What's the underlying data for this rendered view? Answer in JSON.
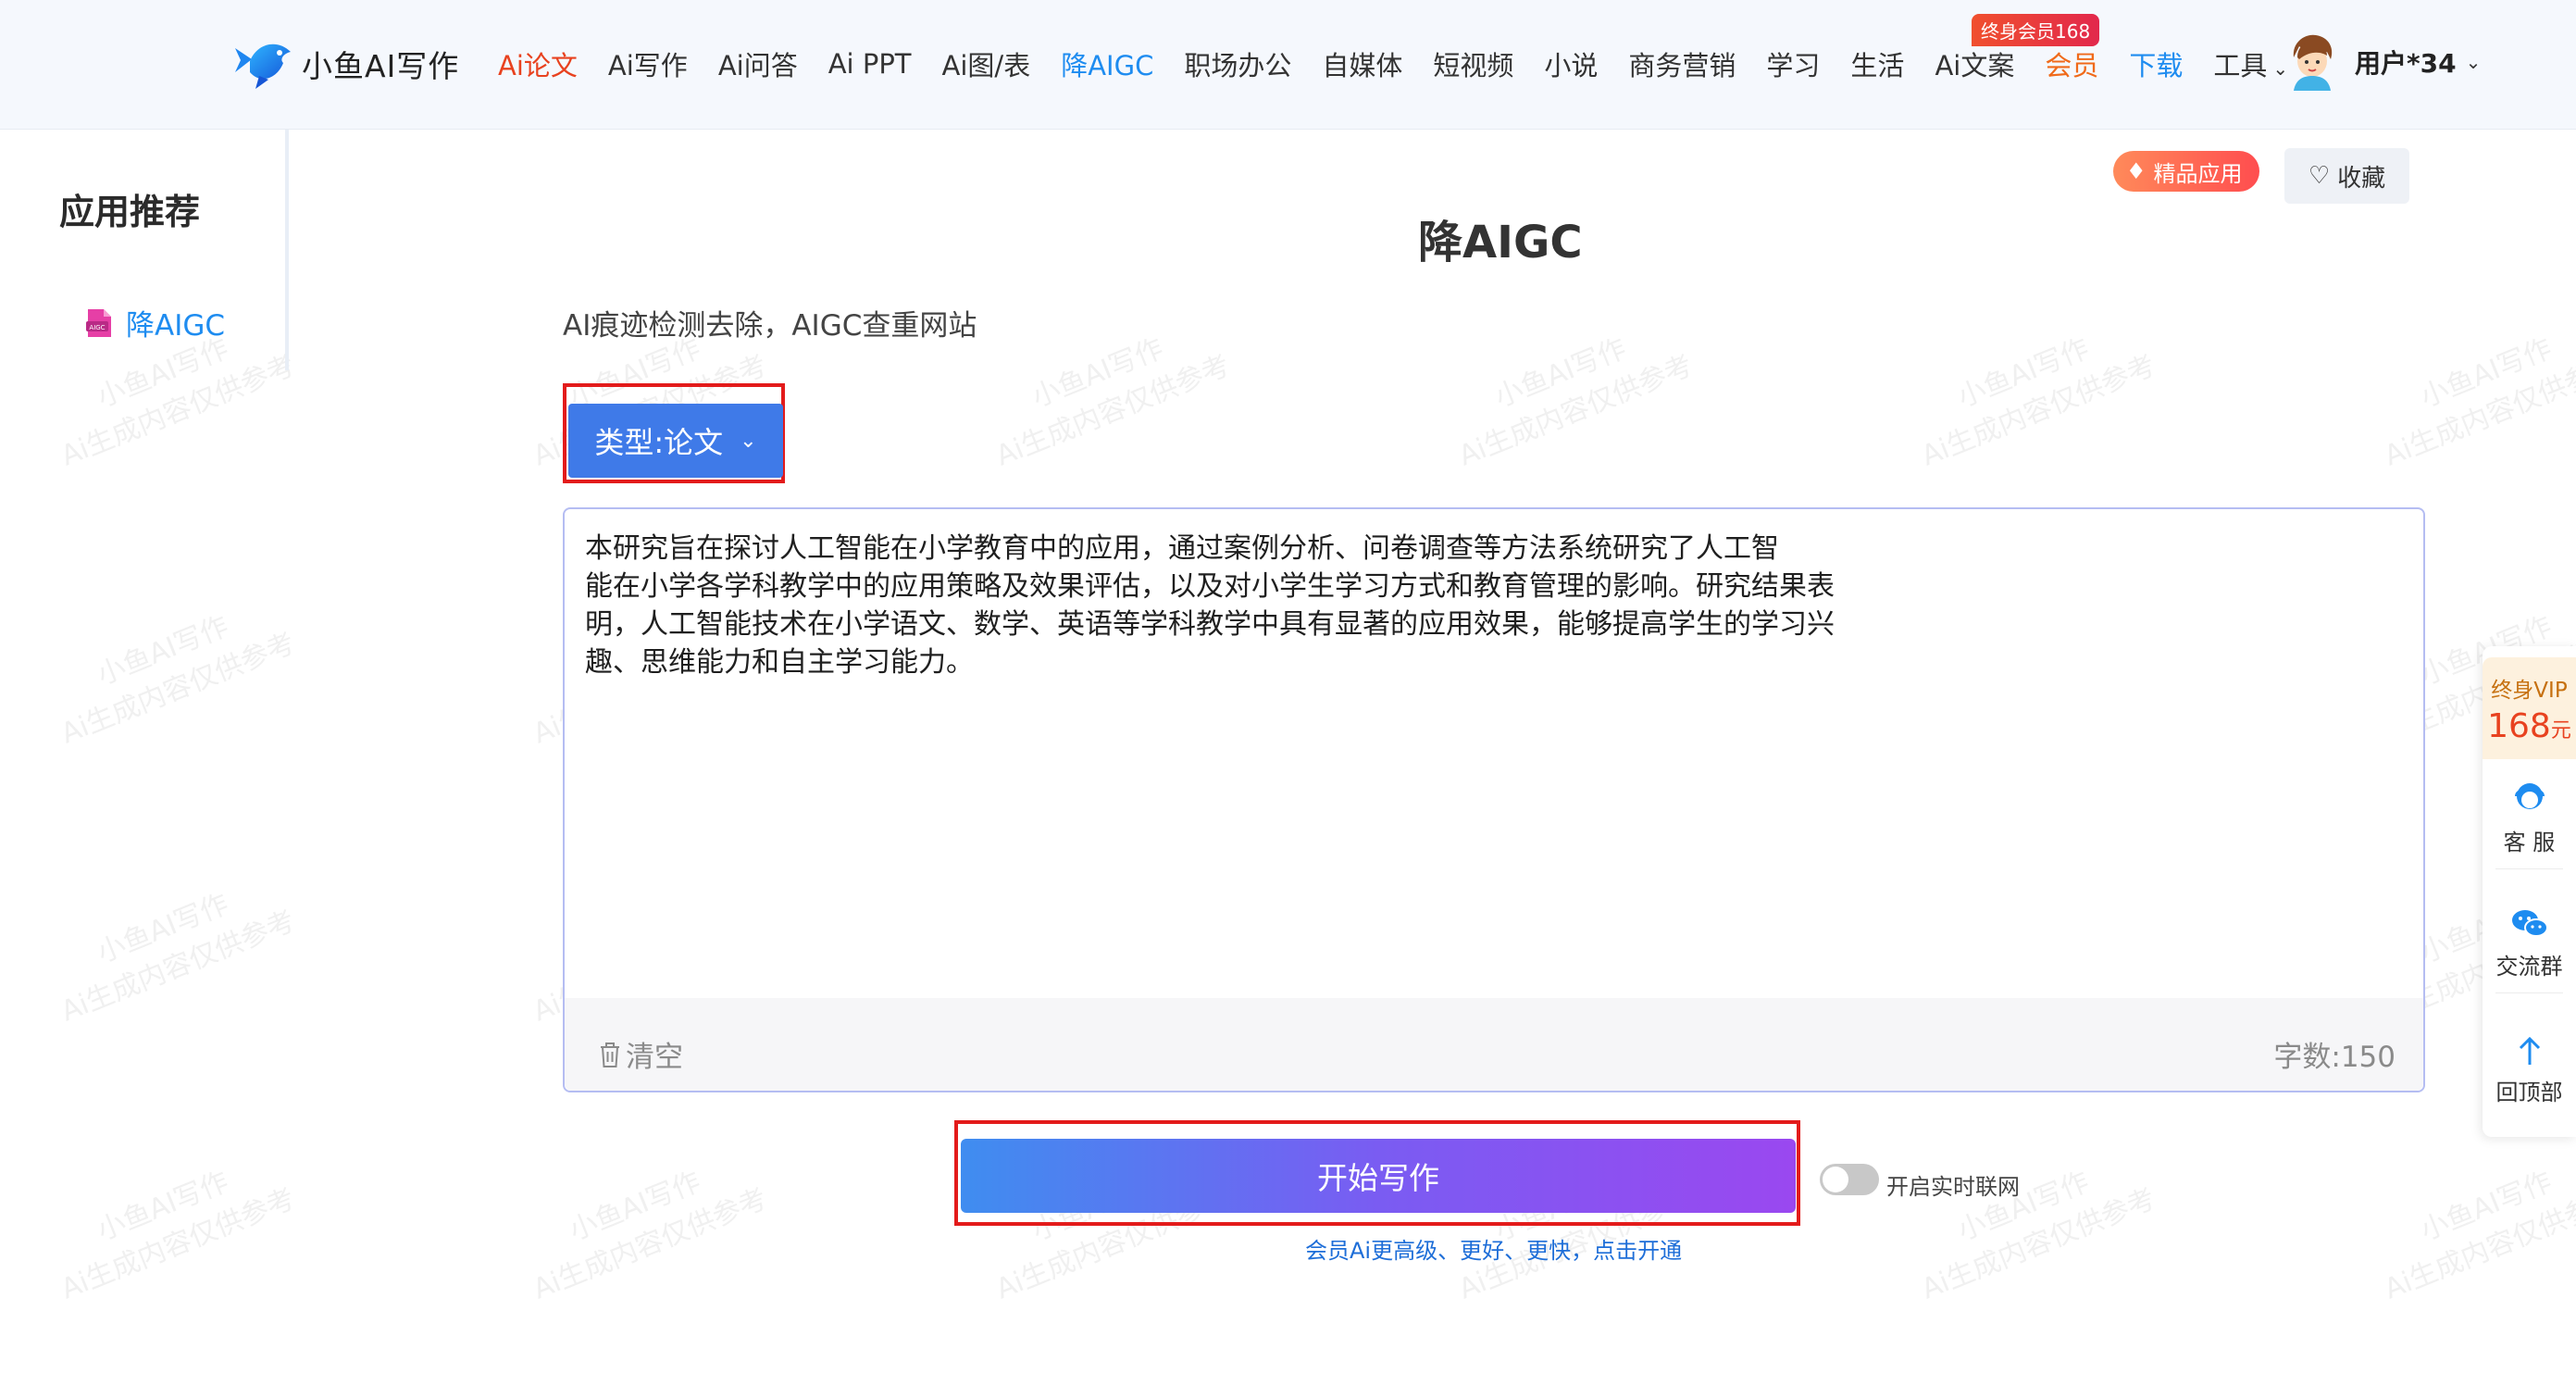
{
  "header": {
    "logo_text": "小鱼AI写作",
    "nav": [
      {
        "label": "Ai论文",
        "style": "red"
      },
      {
        "label": "Ai写作",
        "style": ""
      },
      {
        "label": "Ai问答",
        "style": ""
      },
      {
        "label": "Ai PPT",
        "style": ""
      },
      {
        "label": "Ai图/表",
        "style": ""
      },
      {
        "label": "降AIGC",
        "style": "blue"
      },
      {
        "label": "职场办公",
        "style": ""
      },
      {
        "label": "自媒体",
        "style": ""
      },
      {
        "label": "短视频",
        "style": ""
      },
      {
        "label": "小说",
        "style": ""
      },
      {
        "label": "商务营销",
        "style": ""
      },
      {
        "label": "学习",
        "style": ""
      },
      {
        "label": "生活",
        "style": ""
      },
      {
        "label": "Ai文案",
        "style": ""
      },
      {
        "label": "会员",
        "style": "orange"
      },
      {
        "label": "下载",
        "style": "blue"
      },
      {
        "label": "工具",
        "style": "",
        "dropdown": true
      }
    ],
    "vip_tag": "终身会员168",
    "user_name": "用户*34"
  },
  "sidebar": {
    "title": "应用推荐",
    "items": [
      {
        "label": "降AIGC",
        "icon": "aigc-file-icon"
      }
    ]
  },
  "main": {
    "title": "降AIGC",
    "subtitle": "AI痕迹检测去除，AIGC查重网站",
    "premium_badge": "精品应用",
    "favorite_label": "收藏",
    "type_select": "类型:论文",
    "editor_text": "本研究旨在探讨人工智能在小学教育中的应用，通过案例分析、问卷调查等方法系统研究了人工智\n能在小学各学科教学中的应用策略及效果评估，以及对小学生学习方式和教育管理的影响。研究结果表\n明，人工智能技术在小学语文、数学、英语等学科教学中具有显著的应用效果，能够提高学生的学习兴\n趣、思维能力和自主学习能力。",
    "clear_label": "清空",
    "word_count": "字数:150",
    "start_label": "开始写作",
    "toggle_label": "开启实时联网",
    "toggle_on": false,
    "member_link": "会员Ai更高级、更好、更快，点击开通"
  },
  "float_panel": {
    "vip_label": "终身VIP",
    "vip_price": "168",
    "vip_unit": "元",
    "items": [
      {
        "label": "客 服",
        "icon": "customer-service-icon"
      },
      {
        "label": "交流群",
        "icon": "wechat-icon"
      },
      {
        "label": "回顶部",
        "icon": "arrow-up-icon"
      }
    ]
  },
  "watermark": {
    "line1": "小鱼AI写作",
    "line2": "Ai生成内容仅供参考"
  },
  "colors": {
    "accent_blue": "#1e8cf0",
    "nav_red": "#e8421f",
    "type_button": "#3f7ae8",
    "highlight_box": "#e31b1b"
  }
}
